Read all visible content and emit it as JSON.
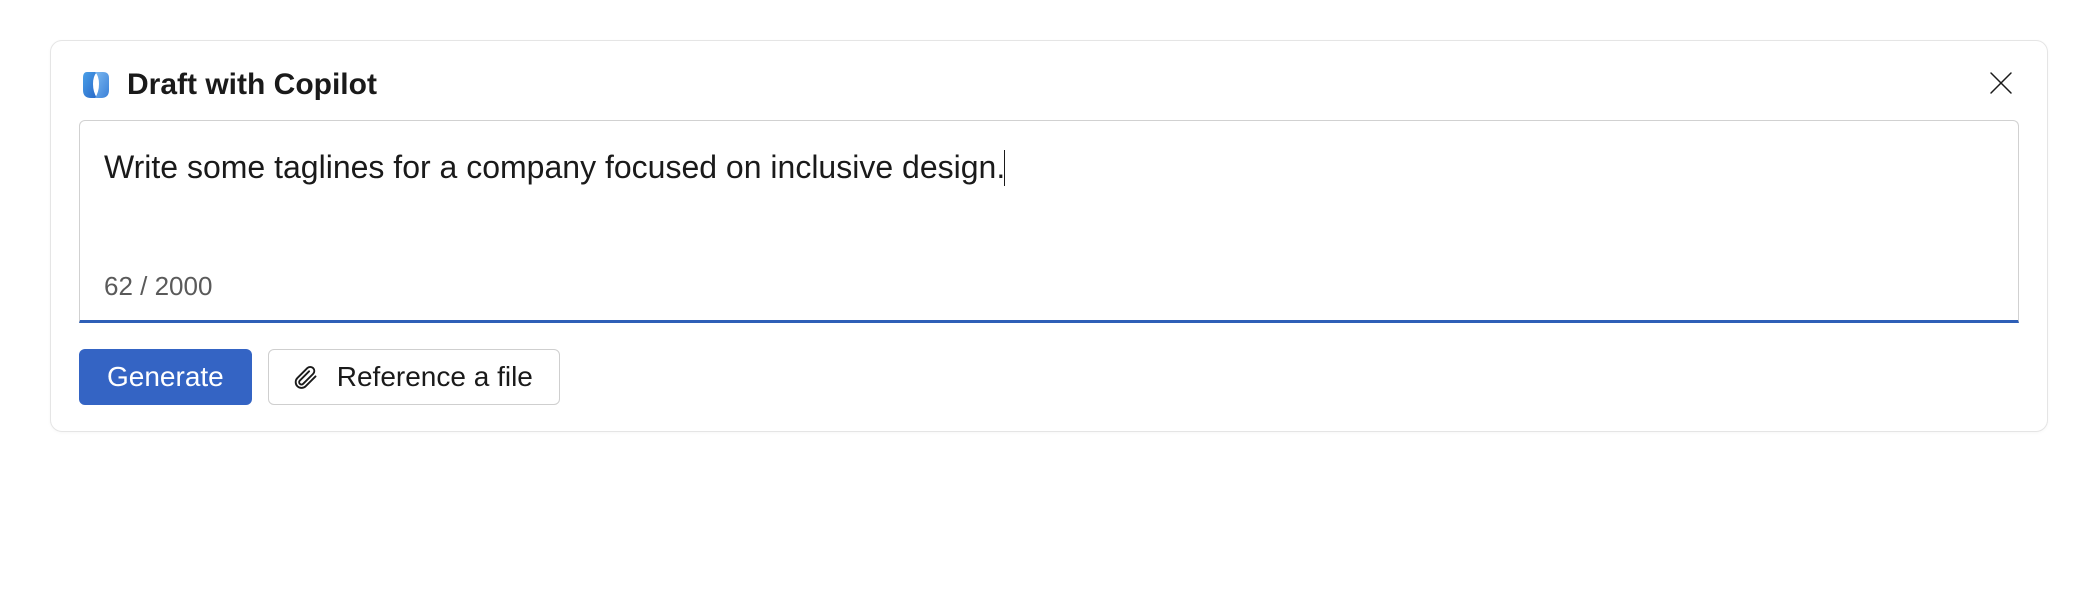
{
  "header": {
    "title": "Draft with Copilot"
  },
  "prompt": {
    "value": "Write some taglines for a company focused on inclusive design.",
    "char_count": "62 / 2000"
  },
  "footer": {
    "generate_label": "Generate",
    "reference_label": "Reference a file"
  }
}
